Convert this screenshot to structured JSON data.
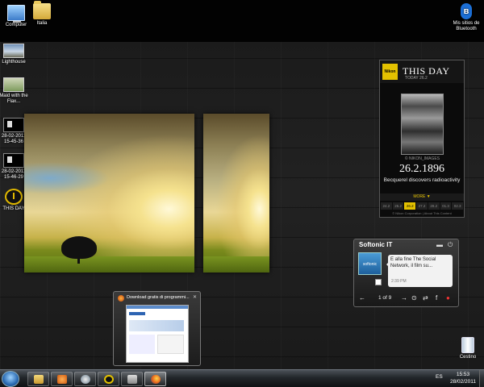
{
  "desktop": {
    "icons": [
      {
        "label": "Computer"
      },
      {
        "label": "Italia"
      },
      {
        "label": "Lighthouse"
      },
      {
        "label": "Maid with the Flax..."
      },
      {
        "label": "28-02-2011 15-45-36"
      },
      {
        "label": "28-02-2011 15-46-29"
      },
      {
        "label": "THIS DAY"
      },
      {
        "label": "Mis sitios de Bluetooth"
      },
      {
        "label": "Cestino"
      }
    ]
  },
  "thisday": {
    "logo": "Nikon",
    "title": "THIS DAY",
    "subtitle": "TODAY 26.2",
    "caption": "© NIKON_IMAGES",
    "date": "26.2.1896",
    "description": "Becquerel discovers radioactivity",
    "more": "MORE ▼",
    "dates": [
      "24.2",
      "25.2",
      "26.2",
      "27.2",
      "28.2",
      "01.3",
      "02.3"
    ],
    "footer": "© Nikon Corporation | About This Content"
  },
  "softonic": {
    "title": "Softonic IT",
    "logo": "softonic",
    "message": "E alla fine The Social Network, il film su...",
    "time": "2:39 PM",
    "counter": "1 of 9",
    "icons": [
      "minimize-icon",
      "power-icon",
      "prev-arrow-icon",
      "next-arrow-icon",
      "play-icon",
      "repeat-icon",
      "facebook-icon",
      "alert-icon"
    ]
  },
  "preview": {
    "title": "Download gratis di programmi..."
  },
  "taskbar": {
    "language": "ES",
    "time": "15:53",
    "date": "28/02/2011"
  },
  "colors": {
    "accent_yellow": "#e3c100",
    "taskbar": "#22262a",
    "desktop": "#1b1b1b"
  }
}
